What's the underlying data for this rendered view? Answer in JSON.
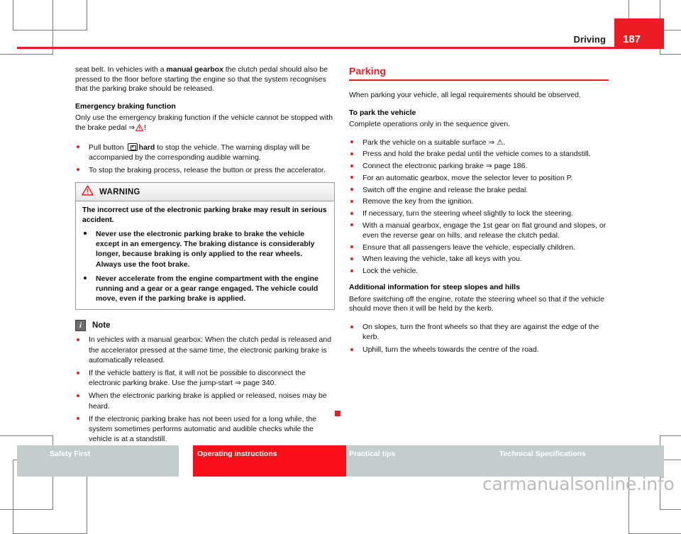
{
  "header": {
    "chapter_title": "Driving",
    "page_number": "187",
    "accent_color": "#ed1c24"
  },
  "left_column": {
    "continued_paragraph_pre": "seat belt. In vehicles with a ",
    "continued_paragraph_bold": "manual gearbox",
    "continued_paragraph_post": " the clutch pedal should also be pressed to the floor before starting the engine so that the system recognises that the parking brake should be released.",
    "emergency_heading": "Emergency braking function",
    "emergency_intro_pre": "Only use the emergency braking function if the vehicle cannot be stopped with the brake pedal ",
    "emergency_intro_ref": "⇒",
    "emergency_intro_post": "!",
    "bullets": [
      {
        "pre": "Pull button ",
        "icon": "parking-brake-switch-icon",
        "bold": "hard",
        "post": " to stop the vehicle. The warning display will be accompanied by the corresponding audible warning."
      },
      {
        "pre": "To stop the braking process, release the button or press the accelerator.",
        "icon": null,
        "bold": "",
        "post": ""
      }
    ],
    "warning": {
      "icon": "warning-triangle-icon",
      "title": "WARNING",
      "intro": "The incorrect use of the electronic parking brake may result in serious accident.",
      "bullets": [
        "Never use the electronic parking brake to brake the vehicle except in an emergency. The braking distance is considerably longer, because braking is only applied to the rear wheels. Always use the foot brake.",
        "Never accelerate from the engine compartment with the engine running and a gear or a gear range engaged. The vehicle could move, even if the parking brake is applied."
      ]
    },
    "note": {
      "icon": "info-icon",
      "icon_glyph": "i",
      "title": "Note",
      "bullets": [
        "In vehicles with a manual gearbox: When the clutch pedal is released and the accelerator pressed at the same time, the electronic parking brake is automatically released.",
        "If the vehicle battery is flat, it will not be possible to disconnect the electronic parking brake. Use the jump-start ⇒ page 340.",
        "When the electronic parking brake is applied or released, noises may be heard.",
        "If the electronic parking brake has not been used for a long while, the system sometimes performs automatic and audible checks while the vehicle is at a standstill."
      ]
    },
    "end_marker": "section-end-square"
  },
  "right_column": {
    "section_heading": "Parking",
    "intro": "When parking your vehicle, all legal requirements should be observed.",
    "park_heading": "To park the vehicle",
    "park_intro": "Complete operations only in the sequence given.",
    "park_bullets": [
      "Park the vehicle on a suitable surface ⇒ ⚠.",
      "Press and hold the brake pedal until the vehicle comes to a standstill.",
      "Connect the electronic parking brake ⇒ page 186.",
      "For an automatic gearbox, move the selector lever to position P.",
      "Switch off the engine and release the brake pedal.",
      "Remove the key from the ignition.",
      "If necessary, turn the steering wheel slightly to lock the steering.",
      "With a manual gearbox, engage the 1st gear on flat ground and slopes, or even the reverse gear on hills, and release the clutch pedal.",
      "Ensure that all passengers leave the vehicle, especially children.",
      "When leaving the vehicle, take all keys with you.",
      "Lock the vehicle."
    ],
    "slopes_heading": "Additional information for steep slopes and hills",
    "slopes_intro": "Before switching off the engine, rotate the steering wheel so that if the vehicle should move then it will be held by the kerb.",
    "slopes_bullets": [
      "On slopes, turn the front wheels so that they are against the edge of the kerb.",
      "Uphill, turn the wheels towards the centre of the road."
    ],
    "continuation_marker": "continues-triangle"
  },
  "footer": {
    "tabs": [
      {
        "label": "Safety First",
        "active": false
      },
      {
        "label": "Operating instructions",
        "active": true
      },
      {
        "label": "Practical tips",
        "active": false
      },
      {
        "label": "Technical Specifications",
        "active": false
      }
    ],
    "active_color": "#fa0f19",
    "inactive_color": "#c3cdcd"
  },
  "watermark": {
    "text": "carmanualsonline.info"
  }
}
